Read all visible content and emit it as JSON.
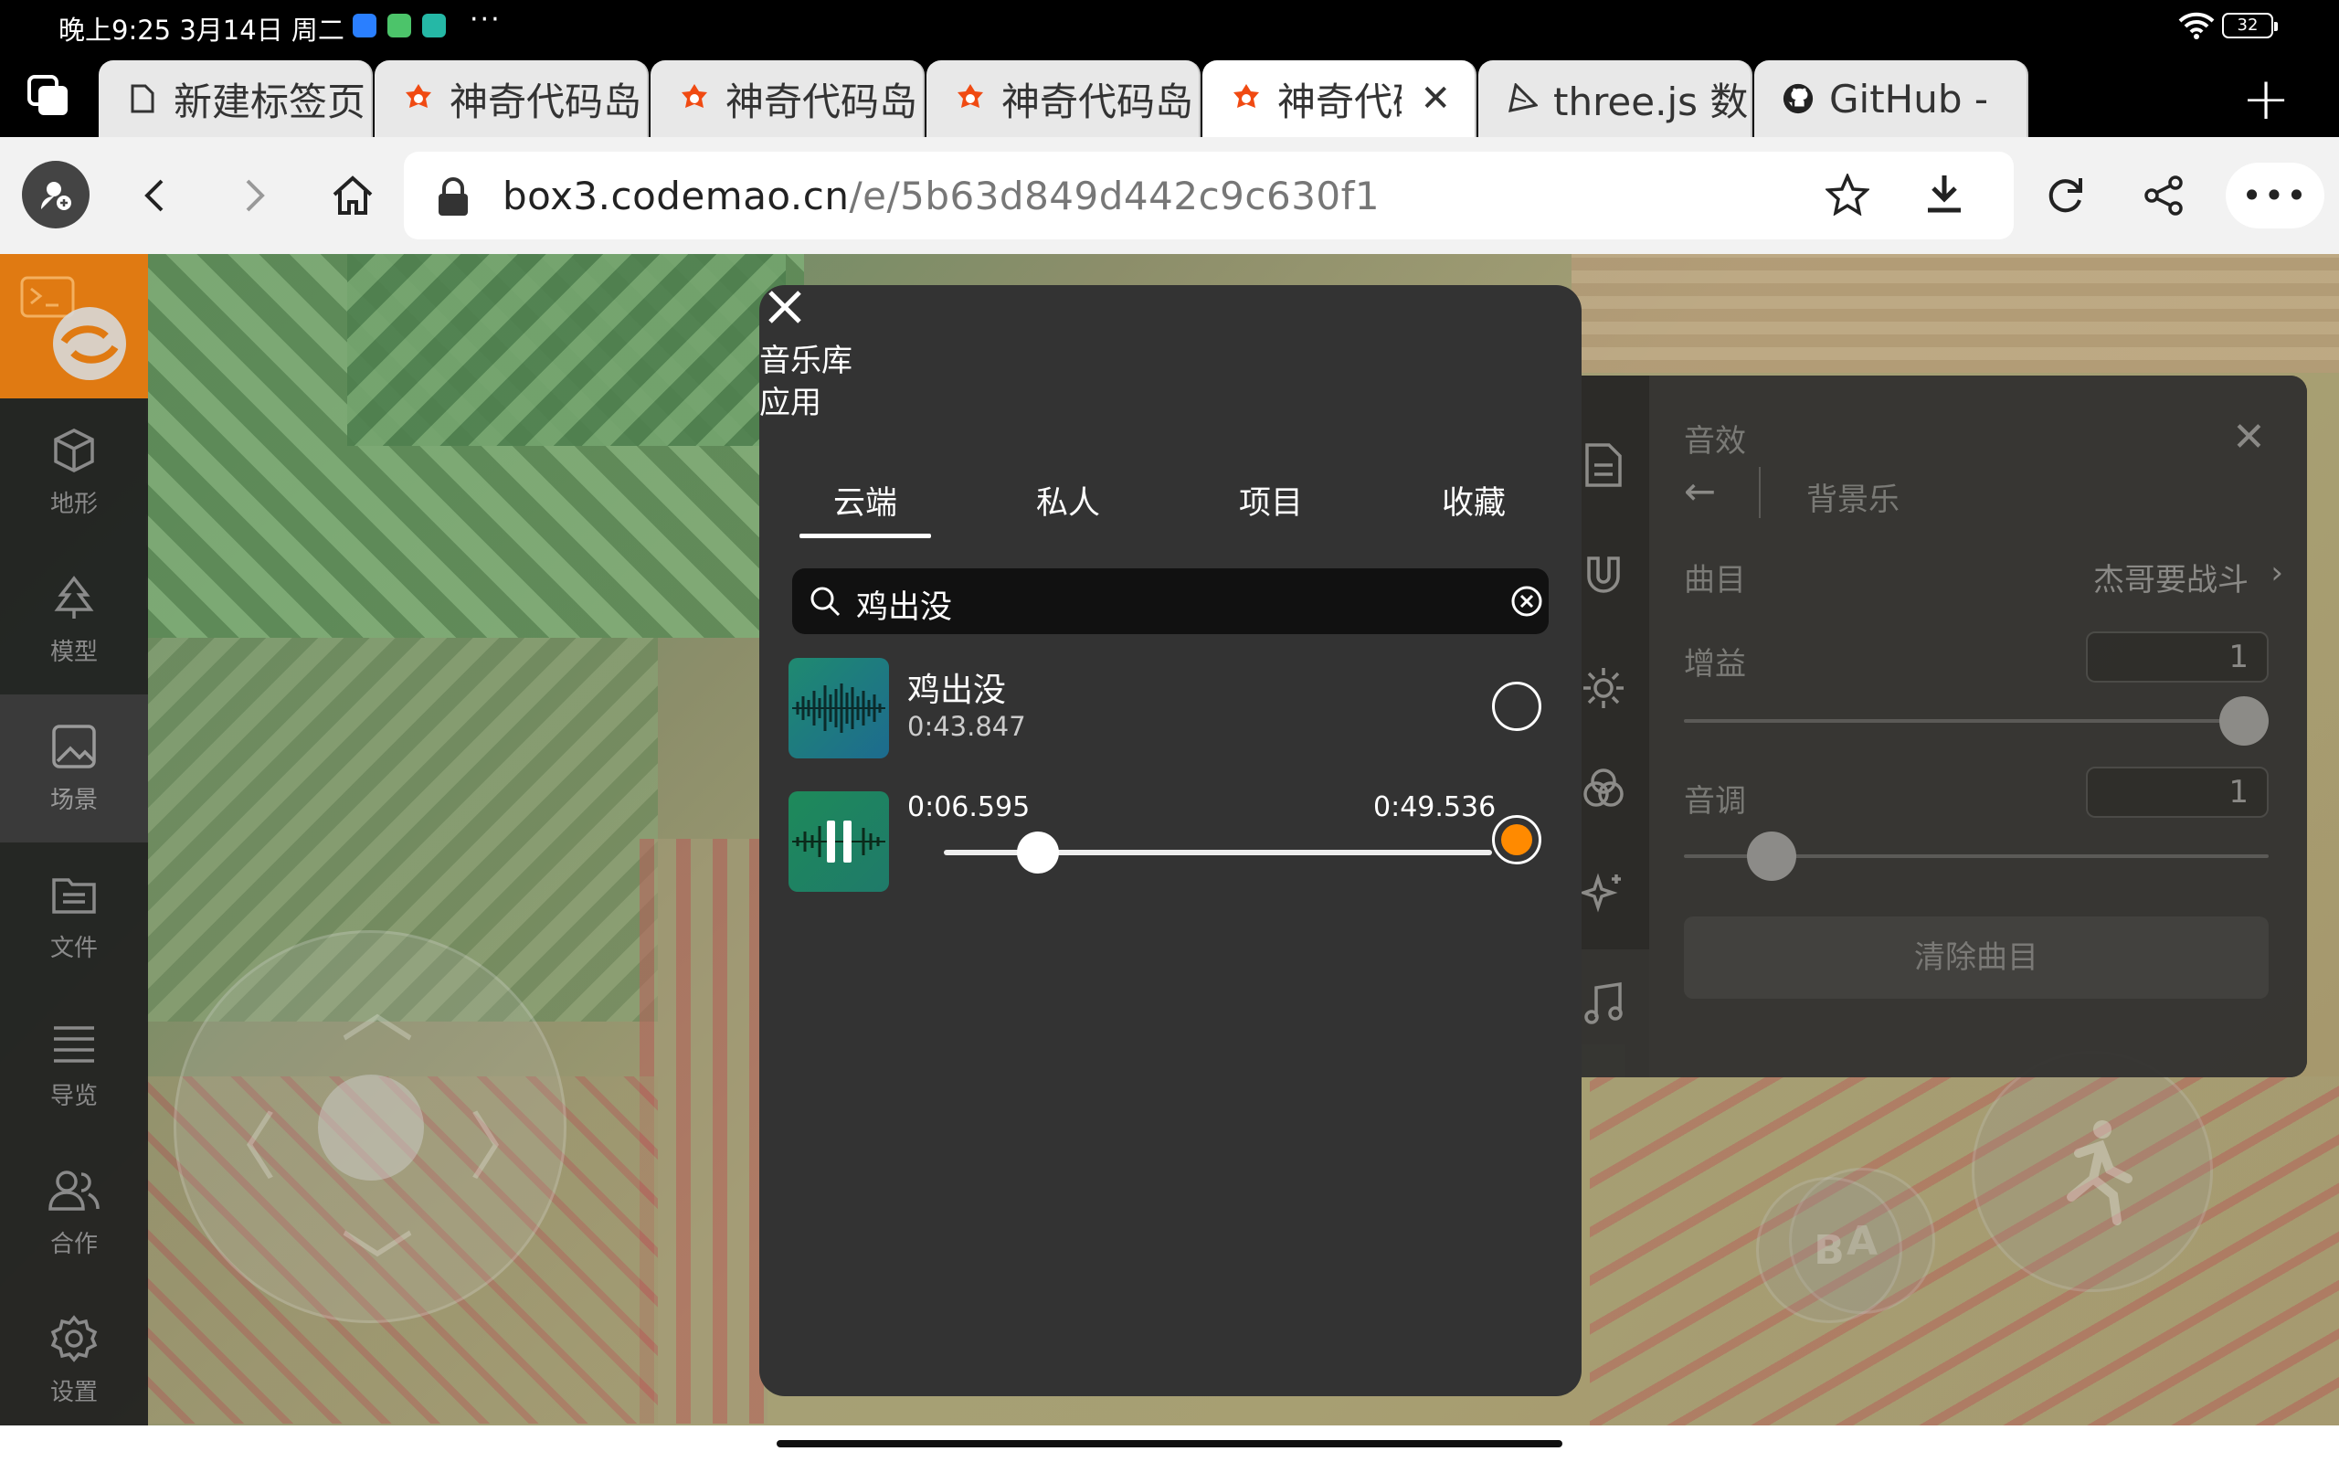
{
  "status_bar": {
    "time": "晚上9:25 3月14日 周二",
    "more": "···",
    "battery": "32"
  },
  "tabs": [
    {
      "label": "新建标签页",
      "icon": "page-icon"
    },
    {
      "label": "神奇代码岛",
      "icon": "codemao-icon"
    },
    {
      "label": "神奇代码岛",
      "icon": "codemao-icon"
    },
    {
      "label": "神奇代码岛",
      "icon": "codemao-icon"
    },
    {
      "label": "神奇代码岛",
      "icon": "codemao-icon",
      "active": true
    },
    {
      "label": "three.js 数",
      "icon": "threejs-icon"
    },
    {
      "label": "GitHub -",
      "icon": "github-icon"
    }
  ],
  "new_tab": "+",
  "address": {
    "host": "box3.codemao.cn",
    "path": "/e/5b63d849d442c9c630f1",
    "more": "•••"
  },
  "sidebar": {
    "items": [
      {
        "label": "地形",
        "icon": "cube-icon"
      },
      {
        "label": "模型",
        "icon": "tree-icon"
      },
      {
        "label": "场景",
        "icon": "image-icon",
        "active": true
      },
      {
        "label": "文件",
        "icon": "folder-icon"
      },
      {
        "label": "导览",
        "icon": "list-icon"
      },
      {
        "label": "合作",
        "icon": "users-icon"
      },
      {
        "label": "设置",
        "icon": "gear-icon"
      }
    ]
  },
  "game_buttons": {
    "a": "A",
    "b": "B"
  },
  "sfx_panel": {
    "title": "音效",
    "subtitle": "背景乐",
    "track_label": "曲目",
    "track_value": "杰哥要战斗",
    "gain_label": "增益",
    "gain_value": "1",
    "gain_level": 1.0,
    "pitch_label": "音调",
    "pitch_value": "1",
    "pitch_level": 0.15,
    "clear_button": "清除曲目"
  },
  "music_dialog": {
    "title": "音乐库",
    "apply": "应用",
    "tabs": [
      "云端",
      "私人",
      "项目",
      "收藏"
    ],
    "active_tab": 0,
    "search_value": "鸡出没",
    "results": [
      {
        "name": "鸡出没",
        "duration": "0:43.847",
        "selected": false
      },
      {
        "current_time": "0:06.595",
        "total_time": "0:49.536",
        "progress": 0.133,
        "selected": true
      }
    ]
  },
  "colors": {
    "accent": "#ff8a00",
    "logo_bg": "#e07a12",
    "dialog_bg": "#333333"
  }
}
